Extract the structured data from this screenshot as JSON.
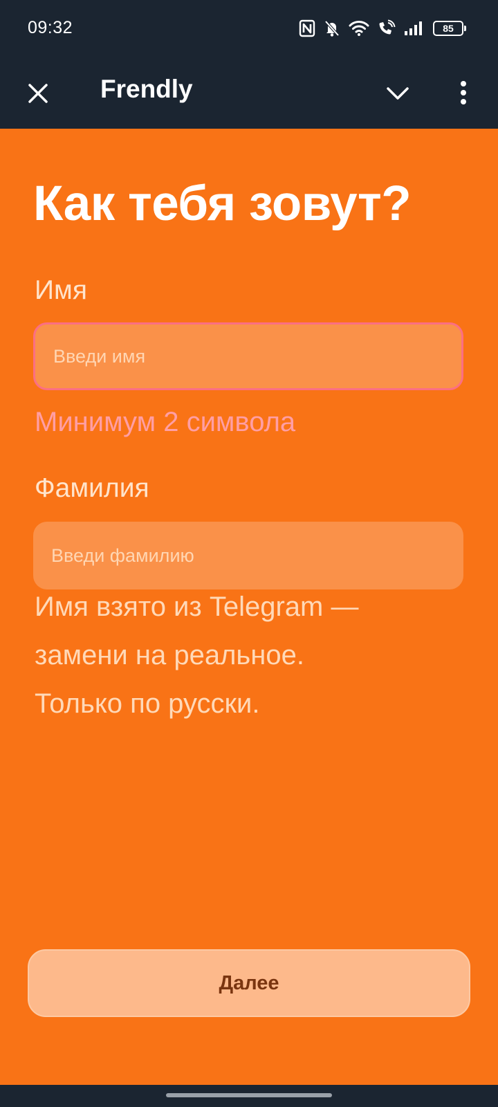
{
  "status_bar": {
    "time": "09:32",
    "icons": [
      "nfc-icon",
      "bell-off-icon",
      "wifi-icon",
      "wifi-calling-icon",
      "signal-icon",
      "battery-icon"
    ],
    "battery_level": "85"
  },
  "app_bar": {
    "title": "Frendly",
    "icons": [
      "close-icon",
      "chevron-down-icon",
      "more-vertical-icon"
    ]
  },
  "form": {
    "title": "Как тебя зовут?",
    "first_name": {
      "label": "Имя",
      "placeholder": "Введи имя",
      "value": "",
      "error": "Минимум 2 символа"
    },
    "last_name": {
      "label": "Фамилия",
      "placeholder": "Введи фамилию",
      "value": ""
    },
    "hint_lines": [
      "Имя взято из Telegram —",
      "замени на реальное.",
      "Только по русски."
    ],
    "next_label": "Далее"
  },
  "colors": {
    "background": "#f97316",
    "chrome": "#1b2531",
    "error_border": "#fb6f83",
    "error_text": "#ff9ea4",
    "button": "#fdb98b",
    "button_text": "#7a3510"
  }
}
